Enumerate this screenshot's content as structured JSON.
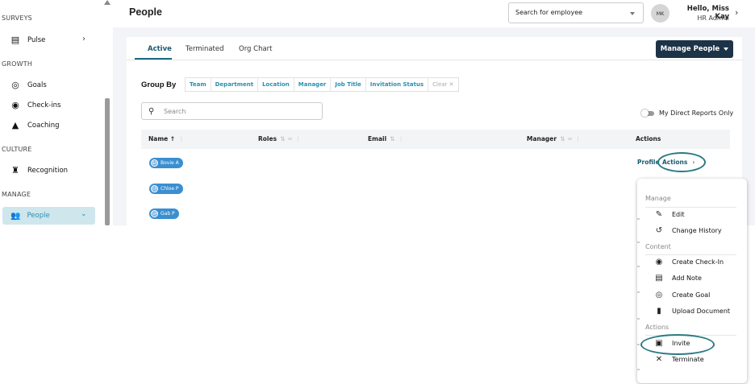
{
  "sidebar": {
    "sections": {
      "surveys": "SURVEYS",
      "growth": "GROWTH",
      "culture": "CULTURE",
      "manage": "MANAGE"
    },
    "items": {
      "pulse": "Pulse",
      "goals": "Goals",
      "checkins": "Check-ins",
      "coaching": "Coaching",
      "recognition": "Recognition",
      "people": "People"
    }
  },
  "header": {
    "title": "People",
    "search_placeholder": "Search for employee",
    "avatar_initials": "MK",
    "greeting": "Hello, Miss Kay",
    "role": "HR Admin"
  },
  "tabs": [
    "Active",
    "Terminated",
    "Org Chart"
  ],
  "manage_button": "Manage People",
  "group_by": {
    "label": "Group By",
    "options": [
      "Team",
      "Department",
      "Location",
      "Manager",
      "Job Title",
      "Invitation Status"
    ],
    "clear": "Clear"
  },
  "search": {
    "placeholder": "Search"
  },
  "direct_reports_label": "My Direct Reports Only",
  "table": {
    "columns": {
      "name": "Name",
      "roles": "Roles",
      "email": "Email",
      "manager": "Manager",
      "actions": "Actions"
    },
    "rows": [
      {
        "initials": "BA",
        "name": "Bovie A"
      },
      {
        "initials": "CP",
        "name": "Chloe P"
      },
      {
        "initials": "GP",
        "name": "Gab P"
      }
    ],
    "profile_link": "Profile",
    "actions_link": "Actions"
  },
  "menu": {
    "sections": {
      "manage": "Manage",
      "content": "Content",
      "actions": "Actions"
    },
    "items": {
      "edit": "Edit",
      "history": "Change History",
      "checkin": "Create Check-In",
      "note": "Add Note",
      "goal": "Create Goal",
      "upload": "Upload Document",
      "invite": "Invite",
      "terminate": "Terminate"
    }
  }
}
